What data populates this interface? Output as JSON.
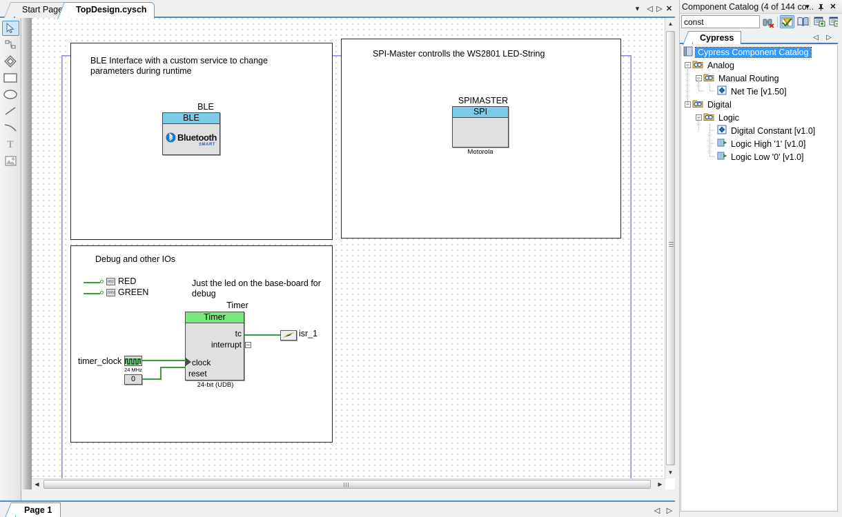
{
  "window": {
    "editor_tabs": [
      {
        "label": "Start Page",
        "active": false
      },
      {
        "label": "TopDesign.cysch",
        "active": true
      }
    ],
    "tab_controls": [
      "dropdown-icon",
      "prev-icon",
      "next-icon",
      "close-icon"
    ],
    "page_tab": "Page 1"
  },
  "toolbar": {
    "tools": [
      {
        "name": "select-tool",
        "icon": "cursor-arrow-icon",
        "selected": true
      },
      {
        "name": "wire-tool",
        "icon": "wire-icon",
        "selected": false
      },
      {
        "name": "component-tool",
        "icon": "diamond-icon",
        "selected": false
      },
      {
        "name": "rectangle-tool",
        "icon": "rectangle-icon",
        "selected": false
      },
      {
        "name": "ellipse-tool",
        "icon": "ellipse-icon",
        "selected": false
      },
      {
        "name": "line-tool",
        "icon": "line-icon",
        "selected": false
      },
      {
        "name": "arc-tool",
        "icon": "arc-icon",
        "selected": false
      },
      {
        "name": "text-tool",
        "icon": "text-t-icon",
        "selected": false
      },
      {
        "name": "image-tool",
        "icon": "picture-icon",
        "selected": false
      }
    ]
  },
  "schematic": {
    "frames": [
      {
        "id": "ble",
        "note": "BLE Interface with a custom service to change\nparameters during runtime",
        "component": {
          "instance": "BLE",
          "header": "BLE",
          "logo": "bluetooth-smart-logo",
          "logo_text": "Bluetooth",
          "logo_sub": "SMART"
        }
      },
      {
        "id": "spi",
        "note": "SPI-Master controlls the WS2801 LED-String",
        "component": {
          "instance": "SPIMASTER",
          "header": "SPI",
          "footer": "Motorola"
        }
      },
      {
        "id": "debug",
        "note": "Debug and other IOs",
        "note2": "Just the led on the base-board for debug",
        "pins": [
          "RED",
          "GREEN"
        ],
        "timer": {
          "instance": "Timer",
          "header": "Timer",
          "footer": "24-bit (UDB)",
          "outputs": [
            "tc",
            "interrupt"
          ],
          "inputs": [
            "clock",
            "reset"
          ]
        },
        "clock": {
          "name": "timer_clock",
          "freq": "24 MHz"
        },
        "constant": {
          "value": "0"
        },
        "isr": {
          "name": "isr_1"
        }
      }
    ]
  },
  "catalog": {
    "title": "Component Catalog (4 of 144 co...",
    "title_controls": [
      "dropdown-icon",
      "pin-icon",
      "close-icon"
    ],
    "search_value": "const",
    "tools": [
      {
        "name": "clear-search-button",
        "icon": "binoculars-clear-icon",
        "active": false
      },
      {
        "name": "filter-button",
        "icon": "funnel-icon",
        "active": true
      },
      {
        "name": "catalog-book-button",
        "icon": "book-icon",
        "active": false
      },
      {
        "name": "expand-all-button",
        "icon": "expand-plus-icon",
        "active": false
      },
      {
        "name": "collapse-all-button",
        "icon": "collapse-minus-icon",
        "active": false
      }
    ],
    "tab": "Cypress",
    "tree": [
      {
        "label": "Cypress Component Catalog",
        "depth": 0,
        "icon": "catalog-book-icon",
        "expander": null,
        "selected": true
      },
      {
        "label": "Analog",
        "depth": 1,
        "icon": "folder-icon",
        "expander": "-",
        "selected": false
      },
      {
        "label": "Manual Routing",
        "depth": 2,
        "icon": "folder-icon",
        "expander": "-",
        "selected": false
      },
      {
        "label": "Net Tie [v1.50]",
        "depth": 3,
        "icon": "component-icon",
        "expander": null,
        "selected": false
      },
      {
        "label": "Digital",
        "depth": 1,
        "icon": "folder-icon",
        "expander": "-",
        "selected": false
      },
      {
        "label": "Logic",
        "depth": 2,
        "icon": "folder-icon",
        "expander": "-",
        "selected": false
      },
      {
        "label": "Digital Constant [v1.0]",
        "depth": 3,
        "icon": "component-icon",
        "expander": null,
        "selected": false
      },
      {
        "label": "Logic High '1' [v1.0]",
        "depth": 3,
        "icon": "logic-block-icon",
        "expander": null,
        "selected": false
      },
      {
        "label": "Logic Low '0' [v1.0]",
        "depth": 3,
        "icon": "logic-block-icon",
        "expander": null,
        "selected": false
      }
    ]
  },
  "colors": {
    "accent": "#3f7fc0",
    "wire": "#3a9c3a",
    "header_blue": "#7ccbe8",
    "header_green": "#7ae87a",
    "selection": "#3399ff"
  }
}
